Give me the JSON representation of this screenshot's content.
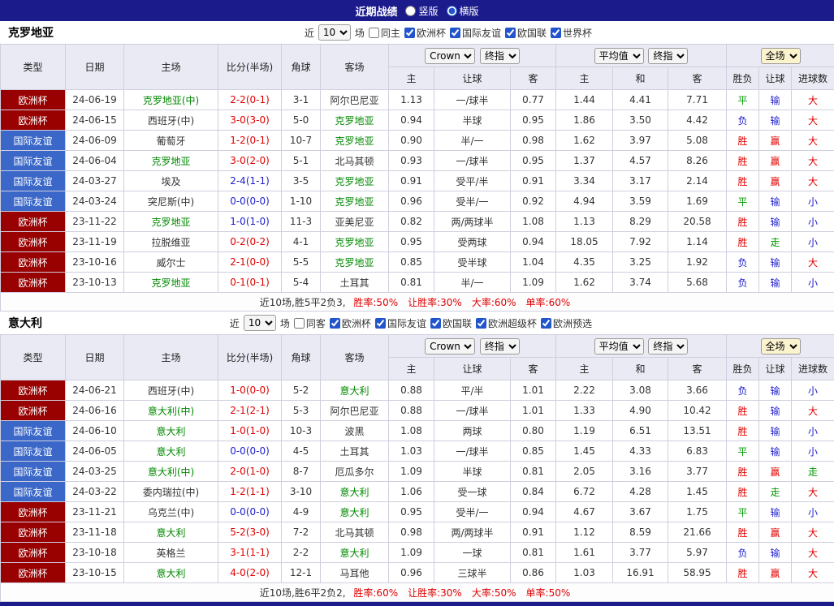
{
  "title_bar": {
    "title": "近期战绩",
    "options": [
      {
        "label": "竖版",
        "selected": false
      },
      {
        "label": "横版",
        "selected": true
      }
    ]
  },
  "labels": {
    "near": "近",
    "games": "场",
    "col_type": "类型",
    "col_date": "日期",
    "col_home": "主场",
    "col_score": "比分(半场)",
    "col_corner": "角球",
    "col_away": "客场",
    "odds_home": "主",
    "odds_handicap": "让球",
    "odds_away": "客",
    "avg_home": "主",
    "avg_draw": "和",
    "avg_away": "客",
    "res_wdl": "胜负",
    "res_handicap": "让球",
    "res_goals": "进球数",
    "sel_bookmaker": "Crown",
    "sel_final": "终指",
    "sel_avg": "平均值",
    "sel_full": "全场"
  },
  "sections": [
    {
      "team": "克罗地亚",
      "filters": {
        "count": "10",
        "same_label": "同主",
        "same_checked": false,
        "leagues": [
          "欧洲杯",
          "国际友谊",
          "欧国联",
          "世界杯"
        ]
      },
      "rows": [
        {
          "type": "欧洲杯",
          "type_color": "red",
          "date": "24-06-19",
          "home": "克罗地亚(中)",
          "home_green": true,
          "score": "2-2(0-1)",
          "score_color": "red",
          "corner": "3-1",
          "away": "阿尔巴尼亚",
          "away_green": false,
          "o_home": "1.13",
          "handicap": "一/球半",
          "o_away": "0.77",
          "avg_home": "1.44",
          "avg_draw": "4.41",
          "avg_away": "7.71",
          "r_wdl": "平",
          "r_wdl_color": "green",
          "r_handicap": "输",
          "r_handicap_color": "blue",
          "r_goals": "大",
          "r_goals_color": "red"
        },
        {
          "type": "欧洲杯",
          "type_color": "red",
          "date": "24-06-15",
          "home": "西班牙(中)",
          "home_green": false,
          "score": "3-0(3-0)",
          "score_color": "red",
          "corner": "5-0",
          "away": "克罗地亚",
          "away_green": true,
          "o_home": "0.94",
          "handicap": "半球",
          "o_away": "0.95",
          "avg_home": "1.86",
          "avg_draw": "3.50",
          "avg_away": "4.42",
          "r_wdl": "负",
          "r_wdl_color": "blue",
          "r_handicap": "输",
          "r_handicap_color": "blue",
          "r_goals": "大",
          "r_goals_color": "red"
        },
        {
          "type": "国际友谊",
          "type_color": "blue",
          "date": "24-06-09",
          "home": "葡萄牙",
          "home_green": false,
          "score": "1-2(0-1)",
          "score_color": "red",
          "corner": "10-7",
          "away": "克罗地亚",
          "away_green": true,
          "o_home": "0.90",
          "handicap": "半/一",
          "o_away": "0.98",
          "avg_home": "1.62",
          "avg_draw": "3.97",
          "avg_away": "5.08",
          "r_wdl": "胜",
          "r_wdl_color": "red",
          "r_handicap": "赢",
          "r_handicap_color": "red",
          "r_goals": "大",
          "r_goals_color": "red"
        },
        {
          "type": "国际友谊",
          "type_color": "blue",
          "date": "24-06-04",
          "home": "克罗地亚",
          "home_green": true,
          "score": "3-0(2-0)",
          "score_color": "red",
          "corner": "5-1",
          "away": "北马其顿",
          "away_green": false,
          "o_home": "0.93",
          "handicap": "一/球半",
          "o_away": "0.95",
          "avg_home": "1.37",
          "avg_draw": "4.57",
          "avg_away": "8.26",
          "r_wdl": "胜",
          "r_wdl_color": "red",
          "r_handicap": "赢",
          "r_handicap_color": "red",
          "r_goals": "大",
          "r_goals_color": "red"
        },
        {
          "type": "国际友谊",
          "type_color": "blue",
          "date": "24-03-27",
          "home": "埃及",
          "home_green": false,
          "score": "2-4(1-1)",
          "score_color": "blue",
          "corner": "3-5",
          "away": "克罗地亚",
          "away_green": true,
          "o_home": "0.91",
          "handicap": "受平/半",
          "o_away": "0.91",
          "avg_home": "3.34",
          "avg_draw": "3.17",
          "avg_away": "2.14",
          "r_wdl": "胜",
          "r_wdl_color": "red",
          "r_handicap": "赢",
          "r_handicap_color": "red",
          "r_goals": "大",
          "r_goals_color": "red"
        },
        {
          "type": "国际友谊",
          "type_color": "blue",
          "date": "24-03-24",
          "home": "突尼斯(中)",
          "home_green": false,
          "score": "0-0(0-0)",
          "score_color": "blue",
          "corner": "1-10",
          "away": "克罗地亚",
          "away_green": true,
          "o_home": "0.96",
          "handicap": "受半/一",
          "o_away": "0.92",
          "avg_home": "4.94",
          "avg_draw": "3.59",
          "avg_away": "1.69",
          "r_wdl": "平",
          "r_wdl_color": "green",
          "r_handicap": "输",
          "r_handicap_color": "blue",
          "r_goals": "小",
          "r_goals_color": "blue"
        },
        {
          "type": "欧洲杯",
          "type_color": "red",
          "date": "23-11-22",
          "home": "克罗地亚",
          "home_green": true,
          "score": "1-0(1-0)",
          "score_color": "blue",
          "corner": "11-3",
          "away": "亚美尼亚",
          "away_green": false,
          "o_home": "0.82",
          "handicap": "两/两球半",
          "o_away": "1.08",
          "avg_home": "1.13",
          "avg_draw": "8.29",
          "avg_away": "20.58",
          "r_wdl": "胜",
          "r_wdl_color": "red",
          "r_handicap": "输",
          "r_handicap_color": "blue",
          "r_goals": "小",
          "r_goals_color": "blue"
        },
        {
          "type": "欧洲杯",
          "type_color": "red",
          "date": "23-11-19",
          "home": "拉脱维亚",
          "home_green": false,
          "score": "0-2(0-2)",
          "score_color": "red",
          "corner": "4-1",
          "away": "克罗地亚",
          "away_green": true,
          "o_home": "0.95",
          "handicap": "受两球",
          "o_away": "0.94",
          "avg_home": "18.05",
          "avg_draw": "7.92",
          "avg_away": "1.14",
          "r_wdl": "胜",
          "r_wdl_color": "red",
          "r_handicap": "走",
          "r_handicap_color": "green",
          "r_goals": "小",
          "r_goals_color": "blue"
        },
        {
          "type": "欧洲杯",
          "type_color": "red",
          "date": "23-10-16",
          "home": "威尔士",
          "home_green": false,
          "score": "2-1(0-0)",
          "score_color": "red",
          "corner": "5-5",
          "away": "克罗地亚",
          "away_green": true,
          "o_home": "0.85",
          "handicap": "受半球",
          "o_away": "1.04",
          "avg_home": "4.35",
          "avg_draw": "3.25",
          "avg_away": "1.92",
          "r_wdl": "负",
          "r_wdl_color": "blue",
          "r_handicap": "输",
          "r_handicap_color": "blue",
          "r_goals": "大",
          "r_goals_color": "red"
        },
        {
          "type": "欧洲杯",
          "type_color": "red",
          "date": "23-10-13",
          "home": "克罗地亚",
          "home_green": true,
          "score": "0-1(0-1)",
          "score_color": "red",
          "corner": "5-4",
          "away": "土耳其",
          "away_green": false,
          "o_home": "0.81",
          "handicap": "半/一",
          "o_away": "1.09",
          "avg_home": "1.62",
          "avg_draw": "3.74",
          "avg_away": "5.68",
          "r_wdl": "负",
          "r_wdl_color": "blue",
          "r_handicap": "输",
          "r_handicap_color": "blue",
          "r_goals": "小",
          "r_goals_color": "blue"
        }
      ],
      "summary": {
        "prefix": "近10场,胜5平2负3,",
        "stats": [
          "胜率:50%",
          "让胜率:30%",
          "大率:60%",
          "单率:60%"
        ]
      }
    },
    {
      "team": "意大利",
      "filters": {
        "count": "10",
        "same_label": "同客",
        "same_checked": false,
        "leagues": [
          "欧洲杯",
          "国际友谊",
          "欧国联",
          "欧洲超级杯",
          "欧洲预选"
        ]
      },
      "rows": [
        {
          "type": "欧洲杯",
          "type_color": "red",
          "date": "24-06-21",
          "home": "西班牙(中)",
          "home_green": false,
          "score": "1-0(0-0)",
          "score_color": "red",
          "corner": "5-2",
          "away": "意大利",
          "away_green": true,
          "o_home": "0.88",
          "handicap": "平/半",
          "o_away": "1.01",
          "avg_home": "2.22",
          "avg_draw": "3.08",
          "avg_away": "3.66",
          "r_wdl": "负",
          "r_wdl_color": "blue",
          "r_handicap": "输",
          "r_handicap_color": "blue",
          "r_goals": "小",
          "r_goals_color": "blue"
        },
        {
          "type": "欧洲杯",
          "type_color": "red",
          "date": "24-06-16",
          "home": "意大利(中)",
          "home_green": true,
          "score": "2-1(2-1)",
          "score_color": "red",
          "corner": "5-3",
          "away": "阿尔巴尼亚",
          "away_green": false,
          "o_home": "0.88",
          "handicap": "一/球半",
          "o_away": "1.01",
          "avg_home": "1.33",
          "avg_draw": "4.90",
          "avg_away": "10.42",
          "r_wdl": "胜",
          "r_wdl_color": "red",
          "r_handicap": "输",
          "r_handicap_color": "blue",
          "r_goals": "大",
          "r_goals_color": "red"
        },
        {
          "type": "国际友谊",
          "type_color": "blue",
          "date": "24-06-10",
          "home": "意大利",
          "home_green": true,
          "score": "1-0(1-0)",
          "score_color": "red",
          "corner": "10-3",
          "away": "波黑",
          "away_green": false,
          "o_home": "1.08",
          "handicap": "两球",
          "o_away": "0.80",
          "avg_home": "1.19",
          "avg_draw": "6.51",
          "avg_away": "13.51",
          "r_wdl": "胜",
          "r_wdl_color": "red",
          "r_handicap": "输",
          "r_handicap_color": "blue",
          "r_goals": "小",
          "r_goals_color": "blue"
        },
        {
          "type": "国际友谊",
          "type_color": "blue",
          "date": "24-06-05",
          "home": "意大利",
          "home_green": true,
          "score": "0-0(0-0)",
          "score_color": "blue",
          "corner": "4-5",
          "away": "土耳其",
          "away_green": false,
          "o_home": "1.03",
          "handicap": "一/球半",
          "o_away": "0.85",
          "avg_home": "1.45",
          "avg_draw": "4.33",
          "avg_away": "6.83",
          "r_wdl": "平",
          "r_wdl_color": "green",
          "r_handicap": "输",
          "r_handicap_color": "blue",
          "r_goals": "小",
          "r_goals_color": "blue"
        },
        {
          "type": "国际友谊",
          "type_color": "blue",
          "date": "24-03-25",
          "home": "意大利(中)",
          "home_green": true,
          "score": "2-0(1-0)",
          "score_color": "red",
          "corner": "8-7",
          "away": "厄瓜多尔",
          "away_green": false,
          "o_home": "1.09",
          "handicap": "半球",
          "o_away": "0.81",
          "avg_home": "2.05",
          "avg_draw": "3.16",
          "avg_away": "3.77",
          "r_wdl": "胜",
          "r_wdl_color": "red",
          "r_handicap": "赢",
          "r_handicap_color": "red",
          "r_goals": "走",
          "r_goals_color": "green"
        },
        {
          "type": "国际友谊",
          "type_color": "blue",
          "date": "24-03-22",
          "home": "委内瑞拉(中)",
          "home_green": false,
          "score": "1-2(1-1)",
          "score_color": "red",
          "corner": "3-10",
          "away": "意大利",
          "away_green": true,
          "o_home": "1.06",
          "handicap": "受一球",
          "o_away": "0.84",
          "avg_home": "6.72",
          "avg_draw": "4.28",
          "avg_away": "1.45",
          "r_wdl": "胜",
          "r_wdl_color": "red",
          "r_handicap": "走",
          "r_handicap_color": "green",
          "r_goals": "大",
          "r_goals_color": "red"
        },
        {
          "type": "欧洲杯",
          "type_color": "red",
          "date": "23-11-21",
          "home": "乌克兰(中)",
          "home_green": false,
          "score": "0-0(0-0)",
          "score_color": "blue",
          "corner": "4-9",
          "away": "意大利",
          "away_green": true,
          "o_home": "0.95",
          "handicap": "受半/一",
          "o_away": "0.94",
          "avg_home": "4.67",
          "avg_draw": "3.67",
          "avg_away": "1.75",
          "r_wdl": "平",
          "r_wdl_color": "green",
          "r_handicap": "输",
          "r_handicap_color": "blue",
          "r_goals": "小",
          "r_goals_color": "blue"
        },
        {
          "type": "欧洲杯",
          "type_color": "red",
          "date": "23-11-18",
          "home": "意大利",
          "home_green": true,
          "score": "5-2(3-0)",
          "score_color": "red",
          "corner": "7-2",
          "away": "北马其顿",
          "away_green": false,
          "o_home": "0.98",
          "handicap": "两/两球半",
          "o_away": "0.91",
          "avg_home": "1.12",
          "avg_draw": "8.59",
          "avg_away": "21.66",
          "r_wdl": "胜",
          "r_wdl_color": "red",
          "r_handicap": "赢",
          "r_handicap_color": "red",
          "r_goals": "大",
          "r_goals_color": "red"
        },
        {
          "type": "欧洲杯",
          "type_color": "red",
          "date": "23-10-18",
          "home": "英格兰",
          "home_green": false,
          "score": "3-1(1-1)",
          "score_color": "red",
          "corner": "2-2",
          "away": "意大利",
          "away_green": true,
          "o_home": "1.09",
          "handicap": "一球",
          "o_away": "0.81",
          "avg_home": "1.61",
          "avg_draw": "3.77",
          "avg_away": "5.97",
          "r_wdl": "负",
          "r_wdl_color": "blue",
          "r_handicap": "输",
          "r_handicap_color": "blue",
          "r_goals": "大",
          "r_goals_color": "red"
        },
        {
          "type": "欧洲杯",
          "type_color": "red",
          "date": "23-10-15",
          "home": "意大利",
          "home_green": true,
          "score": "4-0(2-0)",
          "score_color": "red",
          "corner": "12-1",
          "away": "马耳他",
          "away_green": false,
          "o_home": "0.96",
          "handicap": "三球半",
          "o_away": "0.86",
          "avg_home": "1.03",
          "avg_draw": "16.91",
          "avg_away": "58.95",
          "r_wdl": "胜",
          "r_wdl_color": "red",
          "r_handicap": "赢",
          "r_handicap_color": "red",
          "r_goals": "大",
          "r_goals_color": "red"
        }
      ],
      "summary": {
        "prefix": "近10场,胜6平2负2,",
        "stats": [
          "胜率:60%",
          "让胜率:30%",
          "大率:50%",
          "单率:50%"
        ]
      }
    }
  ]
}
